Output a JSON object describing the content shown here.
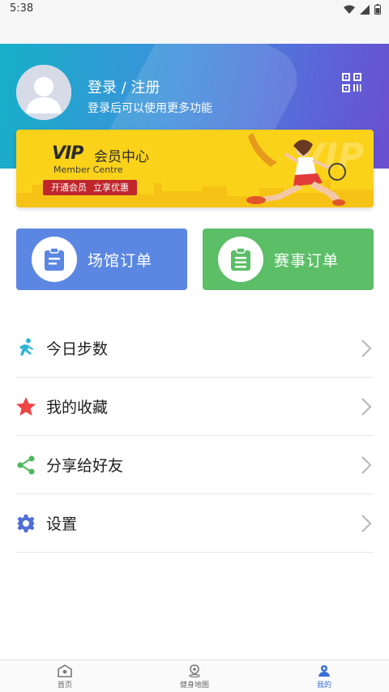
{
  "status_bar": {
    "time": "5:38"
  },
  "profile": {
    "title": "登录 / 注册",
    "subtitle": "登录后可以使用更多功能"
  },
  "vip_banner": {
    "logo": "VIP",
    "title": "会员中心",
    "subtitle": "Member Centre",
    "cta_left": "开通会员",
    "cta_right": "立享优惠",
    "background_text": "VIP"
  },
  "orders": {
    "venue_label": "场馆订单",
    "match_label": "赛事订单"
  },
  "menu": [
    {
      "label": "今日步数",
      "icon": "running-icon"
    },
    {
      "label": "我的收藏",
      "icon": "star-icon"
    },
    {
      "label": "分享给好友",
      "icon": "share-icon"
    },
    {
      "label": "设置",
      "icon": "gear-icon"
    }
  ],
  "tabbar": [
    {
      "label": "首页",
      "icon": "home-icon",
      "active": false
    },
    {
      "label": "健身地图",
      "icon": "map-pin-icon",
      "active": false
    },
    {
      "label": "我的",
      "icon": "user-icon",
      "active": true
    }
  ],
  "colors": {
    "header_gradient_start": "#16b0c8",
    "header_gradient_end": "#6a4fd0",
    "vip_yellow": "#fbd21a",
    "vip_red": "#c0262c",
    "venue_blue": "#5b87e3",
    "match_green": "#5cbe67",
    "tab_active": "#3a6fd8"
  }
}
